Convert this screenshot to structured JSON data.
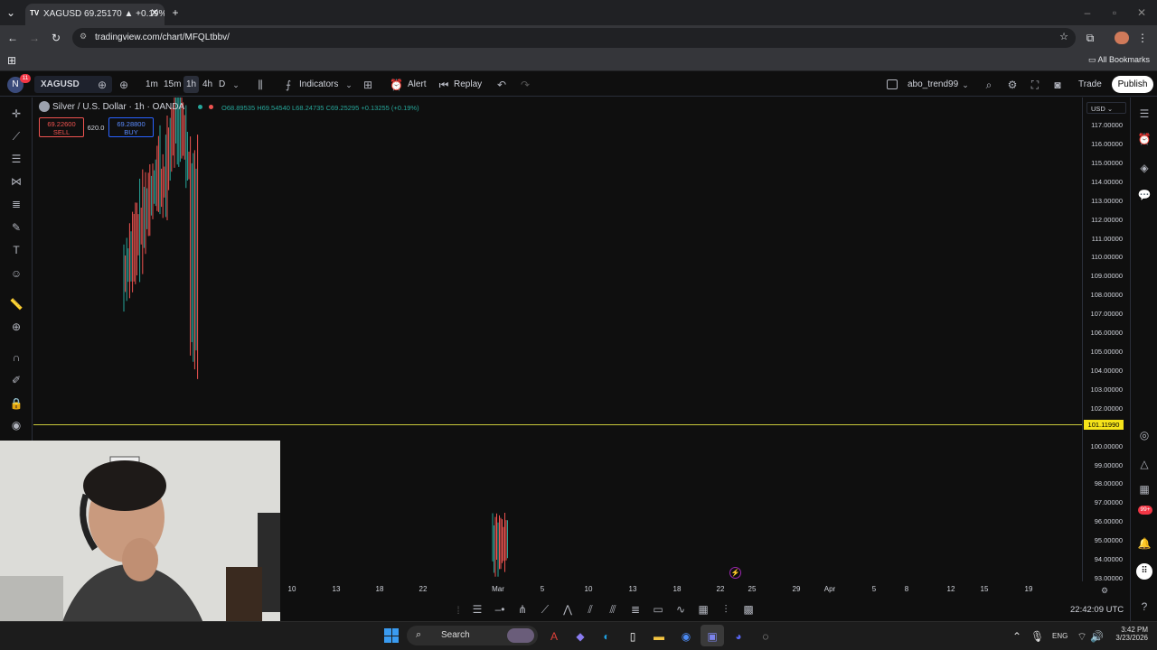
{
  "browser": {
    "tab_title": "XAGUSD 69.25170 ▲ +0.19% a",
    "url": "tradingview.com/chart/MFQLtbbv/",
    "bookmarks_label": "All Bookmarks"
  },
  "toolbar": {
    "avatar_letter": "N",
    "notif_count": "11",
    "symbol": "XAGUSD",
    "intervals": [
      "1m",
      "15m",
      "1h",
      "4h",
      "D"
    ],
    "indicators": "Indicators",
    "alert": "Alert",
    "replay": "Replay",
    "layout_name": "abo_trend99",
    "trade": "Trade",
    "publish": "Publish"
  },
  "legend": {
    "title": "Silver / U.S. Dollar · 1h · OANDA",
    "open": "O68.89535",
    "high": "H69.54540",
    "low": "L68.24735",
    "close": "C69.25295",
    "change": "+0.13255 (+0.19%)"
  },
  "trade_box": {
    "sell_price": "69.22600",
    "sell": "SELL",
    "spread": "620.0",
    "buy_price": "69.28800",
    "buy": "BUY"
  },
  "currency": "USD",
  "price_axis": [
    "117.00000",
    "116.00000",
    "115.00000",
    "114.00000",
    "113.00000",
    "112.00000",
    "111.00000",
    "110.00000",
    "109.00000",
    "108.00000",
    "107.00000",
    "106.00000",
    "105.00000",
    "104.00000",
    "103.00000",
    "102.00000",
    "101.00000",
    "100.00000",
    "99.00000",
    "98.00000",
    "97.00000",
    "96.00000",
    "95.00000",
    "94.00000",
    "93.00000"
  ],
  "hline_label": "101.11990",
  "date_axis": [
    "10",
    "13",
    "18",
    "22",
    "Mar",
    "5",
    "10",
    "13",
    "18",
    "22",
    "25",
    "29",
    "Apr",
    "5",
    "8",
    "12",
    "15",
    "19"
  ],
  "clock": "22:42:09 UTC",
  "taskbar": {
    "search": "Search",
    "lang": "ENG",
    "time": "3:42 PM",
    "date": "3/23/2026"
  },
  "right_badge": "99+",
  "colors": {
    "bg": "#0f0f0f",
    "up": "#26a69a",
    "down": "#ef5350",
    "hline": "#c9c93a",
    "accent": "#2962ff"
  }
}
